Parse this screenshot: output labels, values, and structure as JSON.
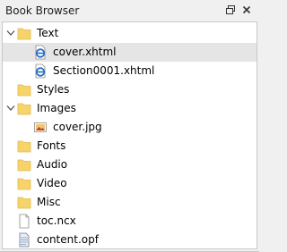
{
  "panel": {
    "title": "Book Browser",
    "buttons": {
      "float": "float-icon",
      "close": "close-icon"
    }
  },
  "tree": [
    {
      "label": "Text",
      "type": "folder",
      "expanded": true,
      "level": 0
    },
    {
      "label": "cover.xhtml",
      "type": "xhtml",
      "level": 1,
      "selected": true
    },
    {
      "label": "Section0001.xhtml",
      "type": "xhtml",
      "level": 1
    },
    {
      "label": "Styles",
      "type": "folder",
      "level": 0
    },
    {
      "label": "Images",
      "type": "folder",
      "expanded": true,
      "level": 0
    },
    {
      "label": "cover.jpg",
      "type": "image",
      "level": 1
    },
    {
      "label": "Fonts",
      "type": "folder",
      "level": 0
    },
    {
      "label": "Audio",
      "type": "folder",
      "level": 0
    },
    {
      "label": "Video",
      "type": "folder",
      "level": 0
    },
    {
      "label": "Misc",
      "type": "folder",
      "level": 0
    },
    {
      "label": "toc.ncx",
      "type": "file",
      "level": 0
    },
    {
      "label": "content.opf",
      "type": "opf",
      "level": 0
    }
  ],
  "colors": {
    "folder": "#f6d46b",
    "folder_dark": "#e2b84a",
    "xhtml_blue": "#2a6fc9",
    "selection": "#e5e5e5"
  }
}
